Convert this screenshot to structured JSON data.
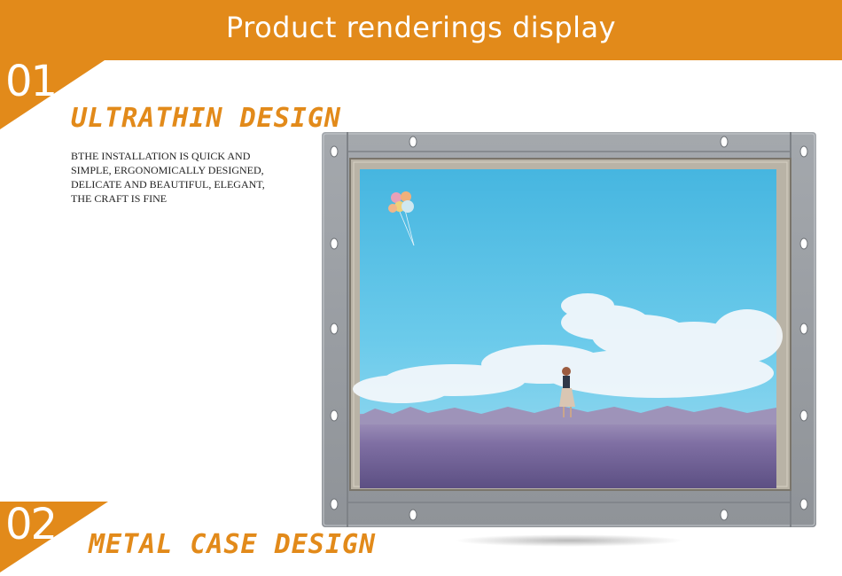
{
  "banner": {
    "title": "Product renderings display"
  },
  "sections": [
    {
      "number": "01",
      "heading": "ULTRATHIN DESIGN",
      "description_lines": [
        "BTHE INSTALLATION IS QUICK AND",
        "SIMPLE, ERGONOMICALLY DESIGNED,",
        "DELICATE AND BEAUTIFUL, ELEGANT,",
        "THE CRAFT IS FINE"
      ]
    },
    {
      "number": "02",
      "heading": "METAL CASE DESIGN"
    }
  ],
  "colors": {
    "accent": "#e28a1a",
    "frame": "#9a9ea3",
    "bezel": "#b9b3a6",
    "sky": "#5cc3e6",
    "field": "#7f6fa3"
  }
}
